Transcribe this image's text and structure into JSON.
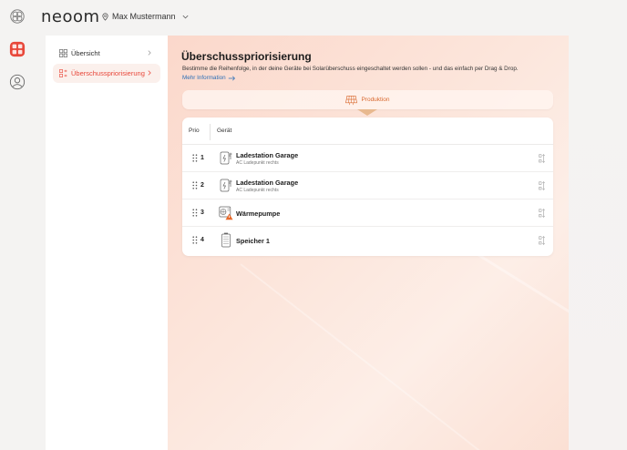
{
  "brand": {
    "name": "neoom"
  },
  "header": {
    "site_name": "Max Mustermann"
  },
  "subnav": {
    "items": [
      {
        "label": "Übersicht"
      },
      {
        "label": "Überschusspriorisierung"
      }
    ]
  },
  "main": {
    "title": "Überschusspriorisierung",
    "description": "Bestimme die Reihenfolge, in der deine Geräte bei Solarüberschuss eingeschaltet werden sollen - und das einfach per Drag & Drop.",
    "more_link": "Mehr Information",
    "production_label": "Produktion",
    "table": {
      "headers": {
        "prio": "Prio",
        "device": "Gerät"
      },
      "rows": [
        {
          "prio": "1",
          "name": "Ladestation Garage",
          "sub": "AC Ladepunkt rechts",
          "icon": "charging-station-icon"
        },
        {
          "prio": "2",
          "name": "Ladestation Garage",
          "sub": "AC Ladepunkt rechts",
          "icon": "charging-station-icon"
        },
        {
          "prio": "3",
          "name": "Wärmepumpe",
          "sub": "",
          "icon": "heat-pump-warning-icon"
        },
        {
          "prio": "4",
          "name": "Speicher 1",
          "sub": "",
          "icon": "battery-icon"
        }
      ]
    }
  },
  "colors": {
    "accent": "#e8473a",
    "production": "#d9692f",
    "link": "#2c6fb7"
  }
}
